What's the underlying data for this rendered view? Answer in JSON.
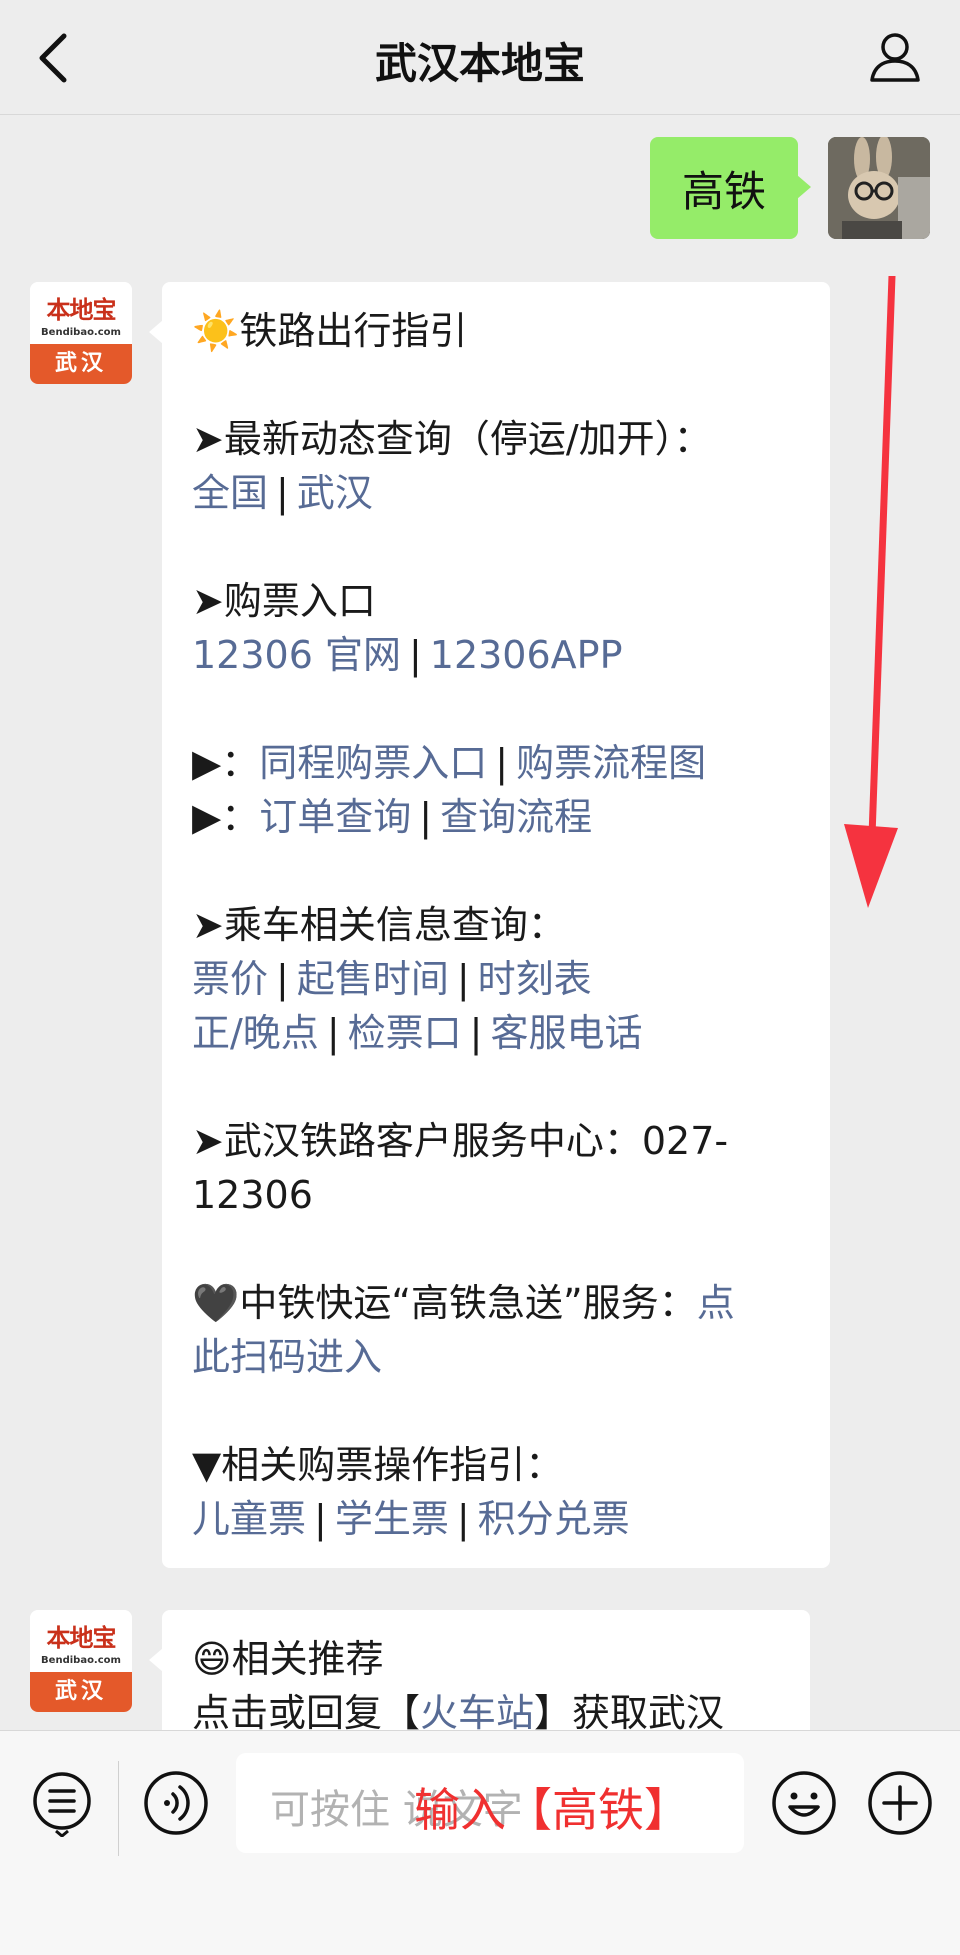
{
  "header": {
    "title": "武汉本地宝"
  },
  "my_message": {
    "text": "高铁"
  },
  "bot": {
    "logo_cn": "本地宝",
    "logo_en": "Bendibao.com",
    "logo_city": "武汉"
  },
  "message1": {
    "title_icon": "☀️",
    "title": "铁路出行指引",
    "s1_head": "➤最新动态查询（停运/加开）：",
    "s1_links": [
      "全国",
      "武汉"
    ],
    "s2_head": "➤购票入口",
    "s2_links": [
      "12306 官网",
      "12306APP"
    ],
    "s3_prefix1": "▶：",
    "s3_links1": [
      "同程购票入口",
      "购票流程图"
    ],
    "s3_prefix2": "▶：",
    "s3_links2": [
      "订单查询",
      "查询流程"
    ],
    "s4_head": "➤乘车相关信息查询：",
    "s4_links1": [
      "票价",
      "起售时间",
      "时刻表"
    ],
    "s4_links2": [
      "正/晚点",
      "检票口",
      "客服电话"
    ],
    "s5_line1": "➤武汉铁路客户服务中心：027-",
    "s5_line2": "12306",
    "s6_text": "🖤中铁快运“高铁急送”服务：",
    "s6_link_a": "点",
    "s6_link_b": "此扫码进入",
    "s7_head": "▼相关购票操作指引：",
    "s7_links": [
      "儿童票",
      "学生票",
      "积分兑票"
    ],
    "separator": "|"
  },
  "message2": {
    "title_icon": "😄",
    "title": "相关推荐",
    "line2_a": "点击或回复【",
    "line2_link": "火车站",
    "line2_b": "】获取武汉"
  },
  "input": {
    "placeholder": "可按住 说文字"
  },
  "overlay": {
    "text": "输入【高铁】"
  },
  "colors": {
    "link": "#576b95",
    "bubble_me": "#95ec69",
    "arrow": "#f5333f",
    "overlay": "#f03030"
  }
}
